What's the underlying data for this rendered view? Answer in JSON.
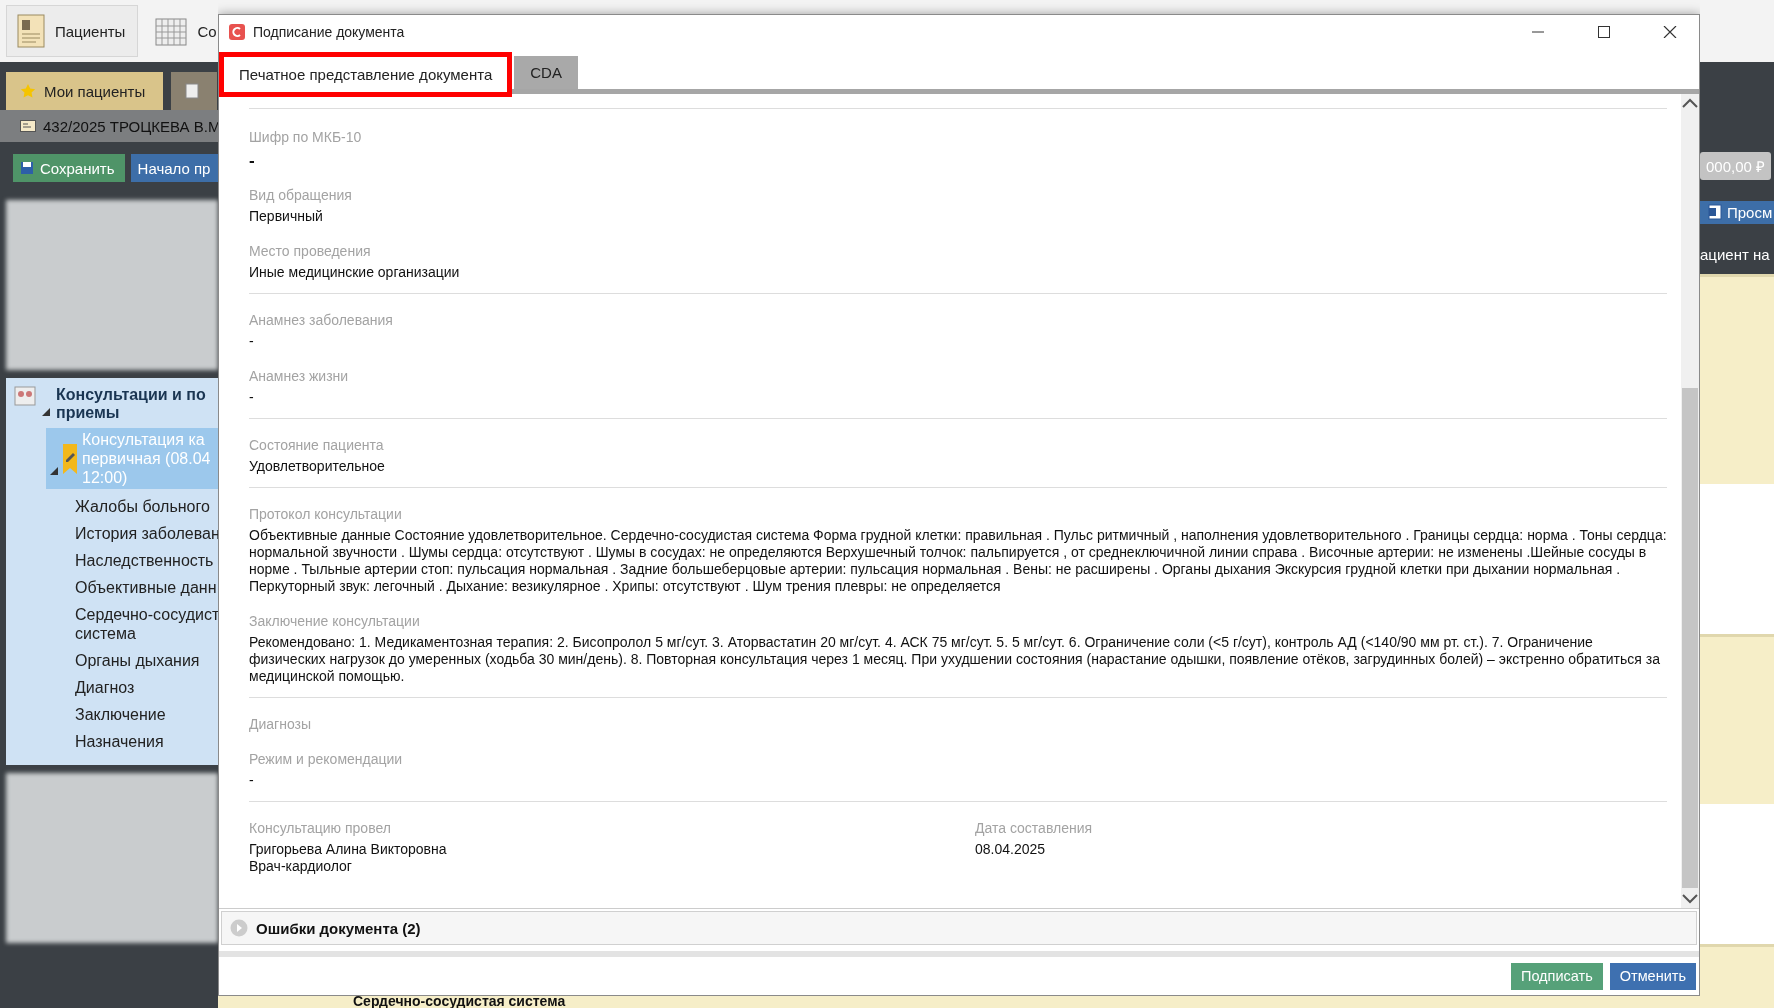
{
  "app": {
    "toolbar": [
      {
        "label": "Пациенты",
        "kind": "patients"
      },
      {
        "label": "Со",
        "kind": "calendar"
      }
    ],
    "tabs": [
      {
        "label": "Мои пациенты",
        "selected": true
      },
      {
        "selected": false
      }
    ],
    "patient": "432/2025 ТРОЦКЕВА В.М",
    "actions": [
      {
        "label": "Сохранить",
        "kind": "save"
      },
      {
        "label": "Начало пр",
        "kind": "start"
      }
    ],
    "tree": {
      "lines": [
        "Консультации и по",
        "приемы"
      ],
      "expanded": true,
      "children": [
        {
          "lines": [
            "Консультация ка",
            "первичная (08.04",
            "12:00)"
          ],
          "expanded": true,
          "selected": true,
          "children": [
            {
              "lines": [
                "Жалобы больного"
              ]
            },
            {
              "lines": [
                "История заболеван"
              ]
            },
            {
              "lines": [
                "Наследственность"
              ]
            },
            {
              "lines": [
                "Объективные данн"
              ]
            },
            {
              "lines": [
                "Сердечно-сосудист",
                "система"
              ]
            },
            {
              "lines": [
                "Органы дыхания"
              ]
            },
            {
              "lines": [
                "Диагноз"
              ]
            },
            {
              "lines": [
                "Заключение"
              ]
            },
            {
              "lines": [
                "Назначения"
              ]
            }
          ]
        }
      ]
    },
    "right_panel": {
      "amount": "000,00 ₽",
      "button": "Просм",
      "text": "ациент на"
    },
    "bottom_heading": "Сердечно-сосудистая система"
  },
  "dialog": {
    "title": "Подписание документа",
    "tabs": [
      {
        "label": "Печатное представление документа",
        "selected": true,
        "highlighted": true
      },
      {
        "label": "CDA",
        "selected": false,
        "highlighted": false
      }
    ],
    "sections": [
      {
        "fields": [
          {
            "label": "Шифр по МКБ-10",
            "value": "-",
            "kind": "code"
          },
          {
            "label": "Вид обращения",
            "value": "Первичный"
          },
          {
            "label": "Место проведения",
            "value": "Иные медицинские организации"
          }
        ]
      },
      {
        "fields": [
          {
            "label": "Анамнез заболевания",
            "value": "-"
          },
          {
            "label": "Анамнез жизни",
            "value": "-"
          }
        ]
      },
      {
        "fields": [
          {
            "label": "Состояние пациента",
            "value": "Удовлетворительное"
          }
        ]
      },
      {
        "fields": [
          {
            "label": "Протокол консультации",
            "value": "Объективные данные Состояние удовлетворительное. Сердечно-сосудистая система Форма грудной клетки: правильная . Пульс ритмичный , наполнения удовлетворительного . Границы сердца: норма . Тоны сердца: нормальной звучности . Шумы сердца: отсутствуют . Шумы в сосудах: не определяются Верхушечный толчок: пальпируется , от среднеключичной линии справа . Височные артерии: не изменены .Шейные сосуды в норме . Тыльные артерии стоп: пульсация нормальная . Задние большеберцовые артерии: пульсация нормальная . Вены: не расширены . Органы дыхания Экскурсия грудной клетки при дыхании нормальная . Перкуторный звук: легочный . Дыхание: везикулярное . Хрипы: отсутствуют . Шум трения плевры: не определяется"
          },
          {
            "label": "Заключение консультации",
            "value": "Рекомендовано: 1. Медикаментозная терапия: 2. Бисопролол 5 мг/сут. 3. Аторвастатин 20 мг/сут. 4. АСК 75 мг/сут. 5. 5 мг/сут. 6. Ограничение соли (<5 г/сут), контроль АД (<140/90 мм рт. ст.). 7. Ограничение физических нагрузок до умеренных (ходьба 30 мин/день). 8. Повторная консультация через 1 месяц. При ухудшении состояния (нарастание одышки, появление отёков, загрудинных болей) – экстренно обратиться за медицинской помощью."
          }
        ]
      },
      {
        "fields": [
          {
            "label": "Диагнозы"
          },
          {
            "label": "Режим и рекомендации",
            "value": "-"
          }
        ]
      },
      {
        "columns": [
          {
            "fields": [
              {
                "label": "Консультацию провел",
                "value": "Григорьева Алина Викторовна\nВрач-кардиолог"
              }
            ]
          },
          {
            "fields": [
              {
                "label": "Дата составления",
                "value": "08.04.2025"
              }
            ]
          }
        ]
      }
    ],
    "errors": {
      "label": "Ошибки документа (2)",
      "expanded": false
    },
    "buttons": [
      {
        "label": "Подписать",
        "kind": "confirm"
      },
      {
        "label": "Отменить",
        "kind": "cancel"
      }
    ]
  }
}
